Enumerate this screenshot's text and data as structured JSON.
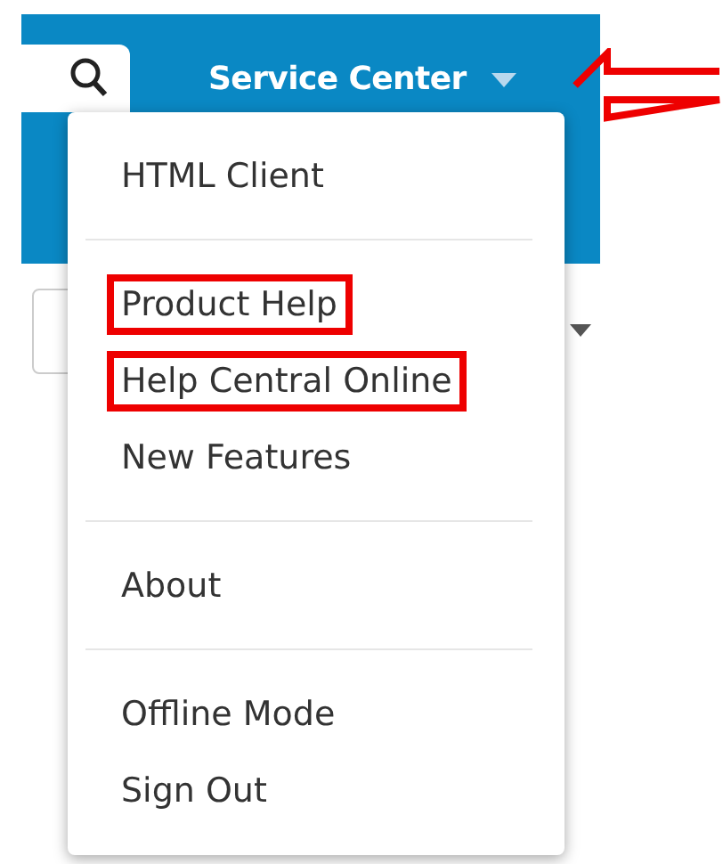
{
  "header": {
    "title": "Service Center",
    "expanded": true
  },
  "menu": {
    "groups": [
      [
        {
          "label": "HTML Client",
          "highlighted": false
        }
      ],
      [
        {
          "label": "Product Help",
          "highlighted": true
        },
        {
          "label": "Help Central Online",
          "highlighted": true
        },
        {
          "label": "New Features",
          "highlighted": false
        }
      ],
      [
        {
          "label": "About",
          "highlighted": false
        }
      ],
      [
        {
          "label": "Offline Mode",
          "highlighted": false
        },
        {
          "label": "Sign Out",
          "highlighted": false
        }
      ]
    ]
  }
}
